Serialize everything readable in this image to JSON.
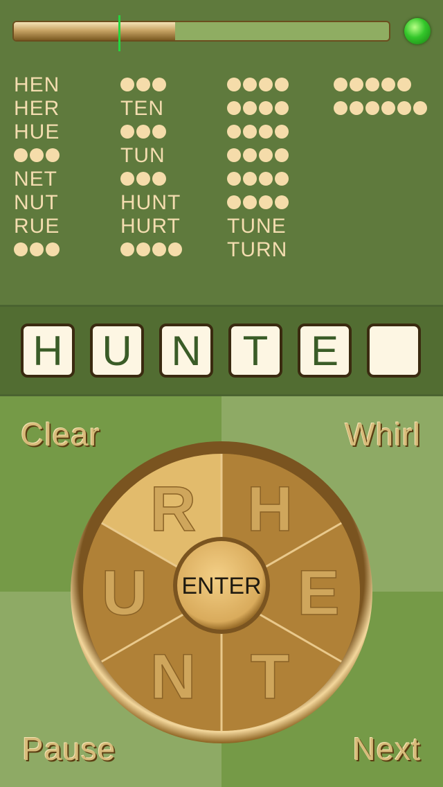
{
  "progress": {
    "value": 0.43,
    "marker": 0.28
  },
  "status_light": {
    "color": "#3fd33a",
    "icon": "green-light-icon"
  },
  "word_columns": [
    [
      {
        "text": "HEN"
      },
      {
        "text": "HER"
      },
      {
        "text": "HUE"
      },
      {
        "hidden": 3
      },
      {
        "text": "NET"
      },
      {
        "text": "NUT"
      },
      {
        "text": "RUE"
      },
      {
        "hidden": 3
      }
    ],
    [
      {
        "hidden": 3
      },
      {
        "text": "TEN"
      },
      {
        "hidden": 3
      },
      {
        "text": "TUN"
      },
      {
        "hidden": 3
      },
      {
        "text": "HUNT"
      },
      {
        "text": "HURT"
      },
      {
        "hidden": 4
      }
    ],
    [
      {
        "hidden": 4
      },
      {
        "hidden": 4
      },
      {
        "hidden": 4
      },
      {
        "hidden": 4
      },
      {
        "hidden": 4
      },
      {
        "hidden": 4
      },
      {
        "text": "TUNE"
      },
      {
        "text": "TURN"
      }
    ],
    [
      {
        "hidden": 5
      },
      {
        "hidden": 6
      }
    ]
  ],
  "entry_tiles": [
    "H",
    "U",
    "N",
    "T",
    "E",
    ""
  ],
  "buttons": {
    "clear": "Clear",
    "whirl": "Whirl",
    "pause": "Pause",
    "next": "Next",
    "enter": "ENTER"
  },
  "wheel": {
    "letters": [
      "R",
      "H",
      "E",
      "T",
      "N",
      "U"
    ],
    "highlighted": "R"
  },
  "colors": {
    "found_word": "#f4ddb0",
    "tile_letter": "#3a5c27",
    "wheel_gold": "#b58a3c"
  }
}
